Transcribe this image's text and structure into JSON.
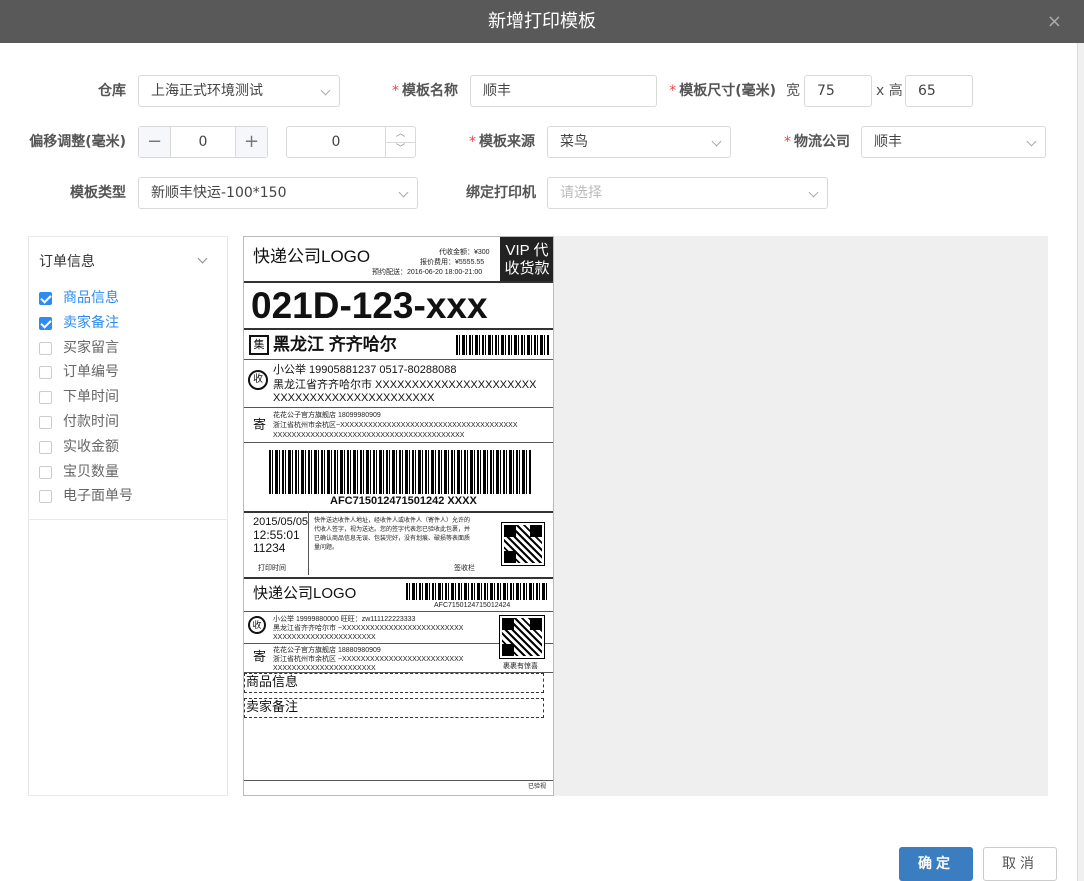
{
  "dialog": {
    "title": "新增打印模板",
    "close_icon": "×"
  },
  "form": {
    "warehouse": {
      "label": "仓库",
      "value": "上海正式环境测试"
    },
    "template_name": {
      "label": "模板名称",
      "value": "顺丰"
    },
    "template_size": {
      "label": "模板尺寸(毫米)",
      "width_label": "宽",
      "width": "75",
      "height_label": "x 高",
      "height": "65"
    },
    "offset": {
      "label": "偏移调整(毫米)",
      "x": "0",
      "y": "0",
      "minus": "−",
      "plus": "+"
    },
    "template_source": {
      "label": "模板来源",
      "value": "菜鸟"
    },
    "logistics_company": {
      "label": "物流公司",
      "value": "顺丰"
    },
    "template_type": {
      "label": "模板类型",
      "value": "新顺丰快运-100*150"
    },
    "printer": {
      "label": "绑定打印机",
      "placeholder": "请选择"
    }
  },
  "fields_panel": {
    "title": "订单信息",
    "items": [
      {
        "label": "商品信息",
        "checked": true
      },
      {
        "label": "卖家备注",
        "checked": true
      },
      {
        "label": "买家留言",
        "checked": false
      },
      {
        "label": "订单编号",
        "checked": false
      },
      {
        "label": "下单时间",
        "checked": false
      },
      {
        "label": "付款时间",
        "checked": false
      },
      {
        "label": "实收金额",
        "checked": false
      },
      {
        "label": "宝贝数量",
        "checked": false
      },
      {
        "label": "电子面单号",
        "checked": false
      }
    ]
  },
  "label": {
    "logo": "快递公司LOGO",
    "cod_amount": "代收金额：¥300",
    "insured_fee": "报价费用：¥5555.55",
    "appointment": "预约配送：2016-06-20 18:00-21:00",
    "vip_line1": "VIP 代",
    "vip_line2": "收货款",
    "sort_code": "021D-123-xxx",
    "jizhong_icon": "集",
    "destination": "黑龙江 齐齐哈尔",
    "receiver_icon": "收",
    "receiver_line": "小公举    19905881237    0517-80288088",
    "receiver_addr1": "黑龙江省齐齐哈尔市 XXXXXXXXXXXXXXXXXXXXXX",
    "receiver_addr2": "XXXXXXXXXXXXXXXXXXXXXX",
    "sender_icon": "寄",
    "sender_line": "花花公子官方旗舰店   18099980909",
    "sender_addr1": "浙江省杭州市余杭区~XXXXXXXXXXXXXXXXXXXXXXXXXXXXXXXXXXXXXX",
    "sender_addr2": "XXXXXXXXXXXXXXXXXXXXXXXXXXXXXXXXXXXXXXXXX",
    "waybill_no": "AFC715012471501242 XXXX",
    "date": "2015/05/05",
    "time": "12:55:01",
    "serial": "11234",
    "notice1": "快件送达收件人地址，经收件人或收件人（寄件人）允许的",
    "notice2": "代收人签字，视为送达。您的签字代表您已验收此包裹，并",
    "notice3": "已确认商品信息无误、包装完好，没有划痕、破损等表面质",
    "notice4": "量问题。",
    "print_time_label": "打印时间",
    "sign_label": "签收栏",
    "logo2": "快递公司LOGO",
    "waybill_no2": "AFC7150124715012424",
    "receiver2_line": "小公举    19999880000    旺旺：zw111122223333",
    "receiver2_addr1": "黑龙江省齐齐哈尔市 ~XXXXXXXXXXXXXXXXXXXXXXXXXX",
    "receiver2_addr2": "XXXXXXXXXXXXXXXXXXXXXX",
    "sender2_line": "花花公子官方旗舰店    18880980909",
    "sender2_addr1": "浙江省杭州市余杭区 ~XXXXXXXXXXXXXXXXXXXXXXXXXX",
    "sender2_addr2": "XXXXXXXXXXXXXXXXXXXXXX",
    "qr_caption": "裹裹有惊喜",
    "field1": "商品信息",
    "field2": "卖家备注",
    "footer_mark": "已验视"
  },
  "actions": {
    "ok": "确定",
    "cancel": "取消"
  }
}
